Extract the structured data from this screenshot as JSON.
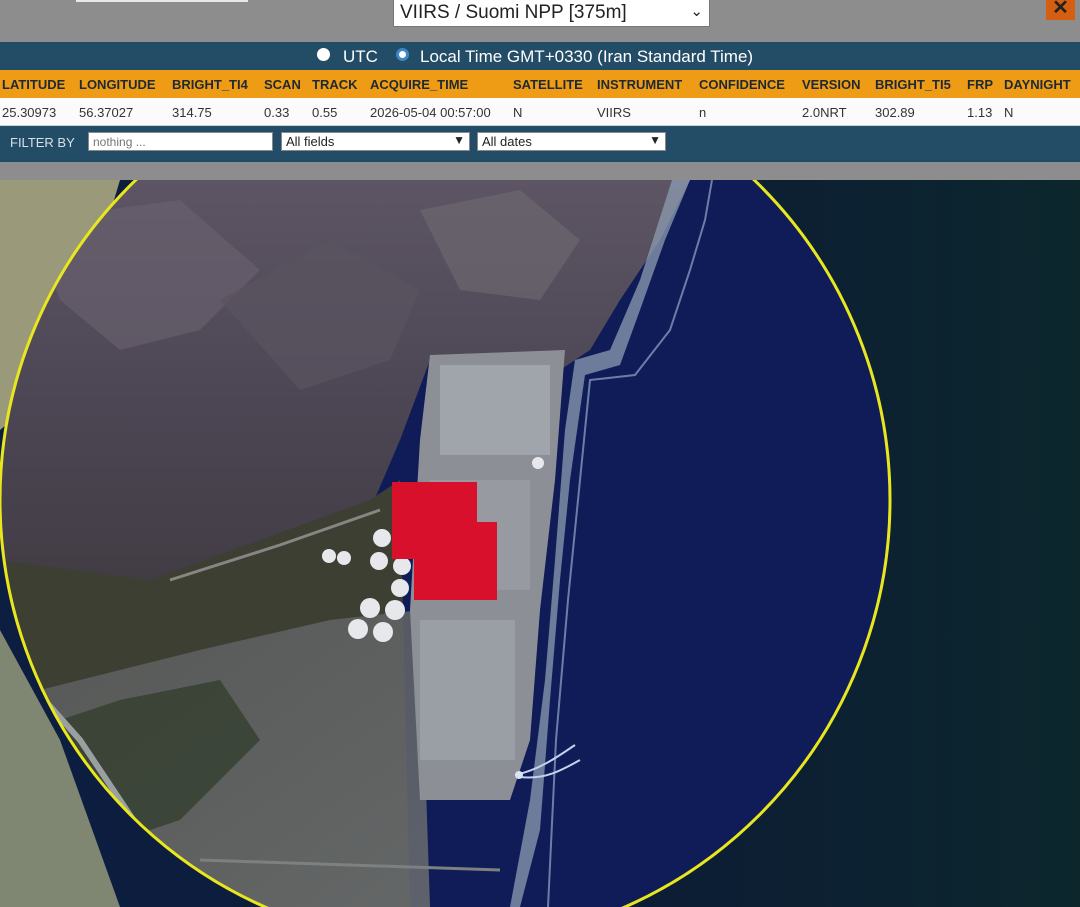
{
  "header": {
    "satellite_select": "VIIRS / Suomi NPP [375m]",
    "close_label": "✕"
  },
  "timezone": {
    "utc_label": "UTC",
    "local_label": "Local Time GMT+0330 (Iran Standard Time)",
    "selected": "local"
  },
  "table": {
    "columns": [
      "LATITUDE",
      "LONGITUDE",
      "BRIGHT_TI4",
      "SCAN",
      "TRACK",
      "ACQUIRE_TIME",
      "SATELLITE",
      "INSTRUMENT",
      "CONFIDENCE",
      "VERSION",
      "BRIGHT_TI5",
      "FRP",
      "DAYNIGHT"
    ],
    "row": [
      "25.30973",
      "56.37027",
      "314.75",
      "0.33",
      "0.55",
      "2026-05-04 00:57:00",
      "N",
      "VIIRS",
      "n",
      "2.0NRT",
      "302.89",
      "1.13",
      "N"
    ]
  },
  "filter": {
    "label": "FILTER BY",
    "input_placeholder": "nothing ...",
    "field_select": "All fields",
    "date_select": "All dates"
  },
  "map": {
    "circle_color": "#e8e61e",
    "fire_color": "#d8102b",
    "sea_color": "#0f1a52"
  }
}
